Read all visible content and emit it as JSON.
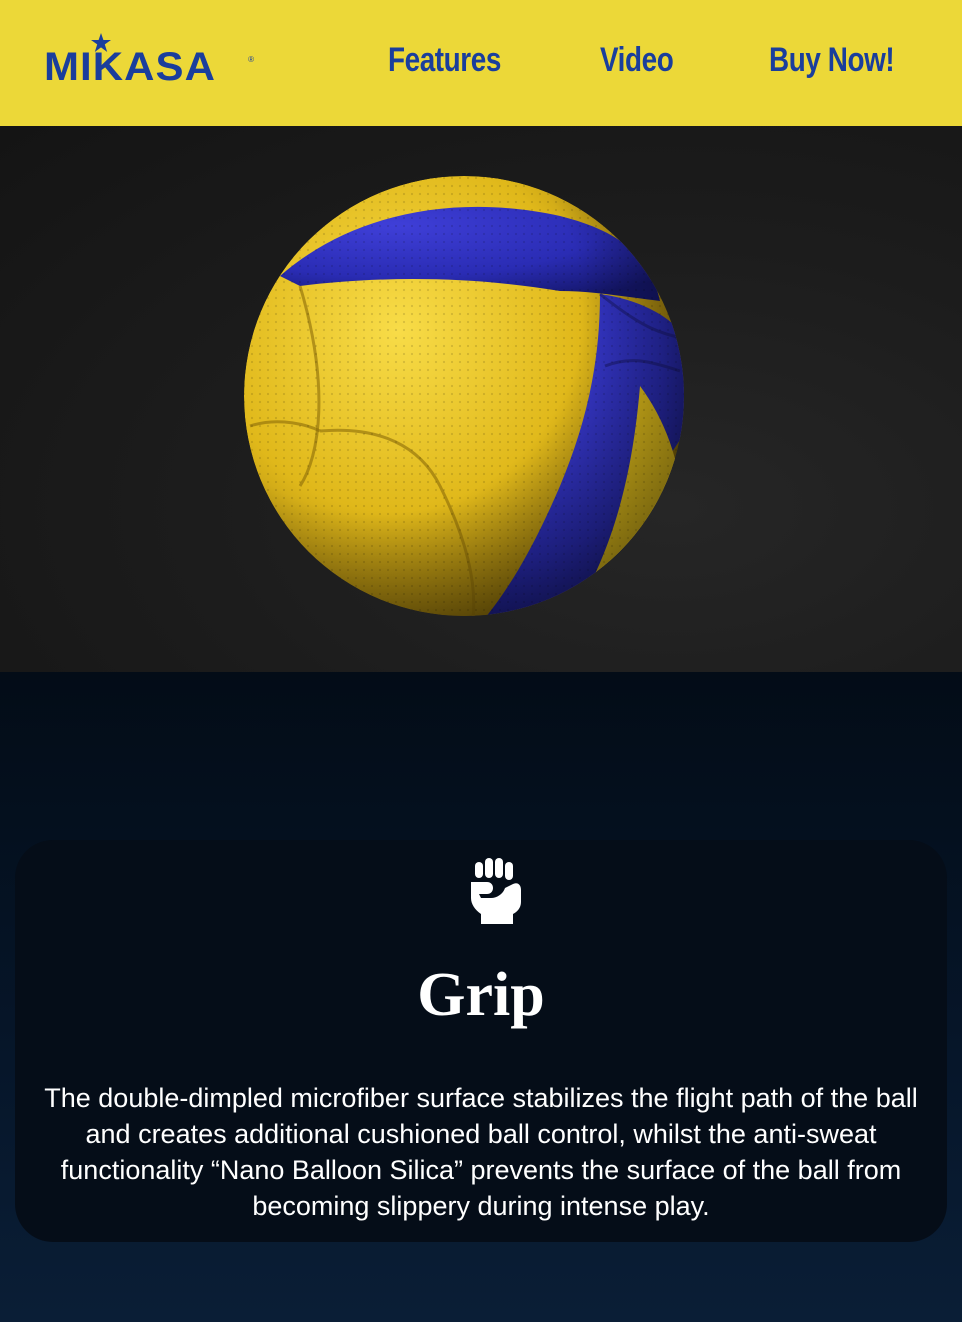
{
  "header": {
    "brand": "MIKASA",
    "brand_mark": "®",
    "nav": {
      "features": "Features",
      "video": "Video",
      "buy": "Buy Now!"
    }
  },
  "feature": {
    "icon": "fist-icon",
    "title": "Grip",
    "description": "The double-dimpled microfiber surface stabilizes the flight path of the ball and creates additional cushioned ball control, whilst the anti-sweat functionality “Nano Balloon Silica” prevents the surface of the ball from becoming slippery during intense play."
  },
  "colors": {
    "header_bg": "#ecd838",
    "brand_blue": "#1a3e9c",
    "ball_yellow": "#e8c418",
    "ball_blue": "#2a2fb5",
    "card_bg": "#050d18"
  }
}
